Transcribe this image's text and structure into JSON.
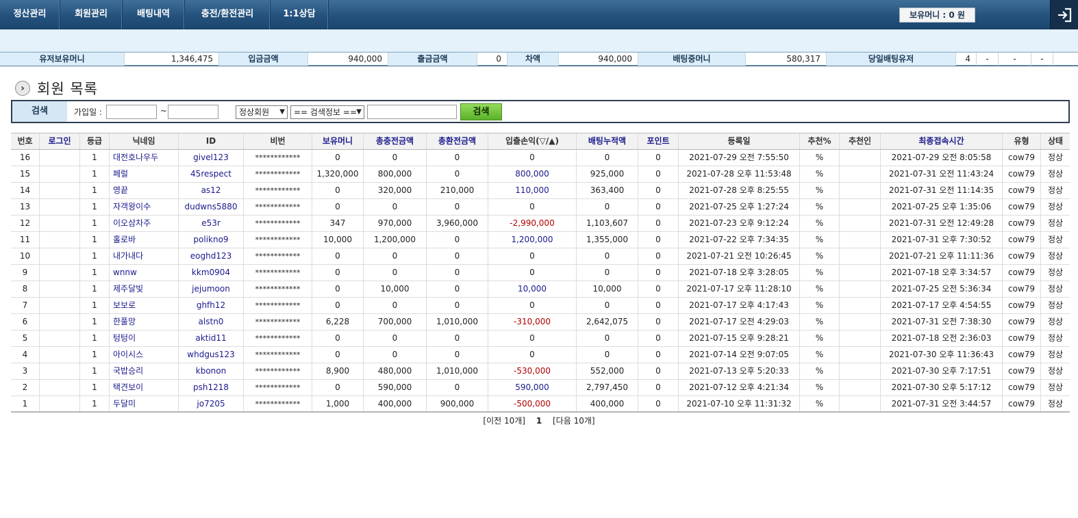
{
  "nav": {
    "items": [
      {
        "label": "정산관리"
      },
      {
        "label": "회원관리"
      },
      {
        "label": "배팅내역"
      },
      {
        "label": "충전/환전관리"
      },
      {
        "label": "1:1상담"
      }
    ],
    "money_text": "보유머니 : 0 원"
  },
  "stats": {
    "user_money_label": "유저보유머니",
    "user_money": "1,346,475",
    "deposit_label": "입금금액",
    "deposit": "940,000",
    "withdraw_label": "출금금액",
    "withdraw": "0",
    "diff_label": "차액",
    "diff": "940,000",
    "betting_label": "배팅중머니",
    "betting": "580,317",
    "today_label": "당일배팅유저",
    "today": "4",
    "dash1": "-",
    "dash2": "-",
    "dash3": "-"
  },
  "page_title": "회원 목록",
  "search": {
    "label": "검색",
    "join_label": "가입일 :",
    "tilde": "~",
    "date_from": "",
    "date_to": "",
    "status_select": "정상회원",
    "field_select": "== 검색정보 ==",
    "keyword": "",
    "button": "검색"
  },
  "table": {
    "headers": [
      "번호",
      "로그인",
      "등급",
      "닉네임",
      "ID",
      "비번",
      "보유머니",
      "총충전금액",
      "총환전금액",
      "입출손익(▽/▲)",
      "배팅누적액",
      "포인트",
      "등록일",
      "추천%",
      "추천인",
      "최종접속시간",
      "유형",
      "상태"
    ],
    "rows": [
      [
        "16",
        "",
        "1",
        "대전호나우두",
        "givel123",
        "************",
        "0",
        "0",
        "0",
        "0",
        "0",
        "0",
        "2021-07-29 오전 7:55:50",
        "%",
        "",
        "2021-07-29 오전 8:05:58",
        "cow79",
        "정상"
      ],
      [
        "15",
        "",
        "1",
        "페럴",
        "45respect",
        "************",
        "1,320,000",
        "800,000",
        "0",
        "800,000",
        "925,000",
        "0",
        "2021-07-28 오후 11:53:48",
        "%",
        "",
        "2021-07-31 오전 11:43:24",
        "cow79",
        "정상"
      ],
      [
        "14",
        "",
        "1",
        "영끝",
        "as12",
        "************",
        "0",
        "320,000",
        "210,000",
        "110,000",
        "363,400",
        "0",
        "2021-07-28 오후 8:25:55",
        "%",
        "",
        "2021-07-31 오전 11:14:35",
        "cow79",
        "정상"
      ],
      [
        "13",
        "",
        "1",
        "자객왕이수",
        "dudwns5880",
        "************",
        "0",
        "0",
        "0",
        "0",
        "0",
        "0",
        "2021-07-25 오후 1:27:24",
        "%",
        "",
        "2021-07-25 오후 1:35:06",
        "cow79",
        "정상"
      ],
      [
        "12",
        "",
        "1",
        "이오삼차주",
        "e53r",
        "************",
        "347",
        "970,000",
        "3,960,000",
        "-2,990,000",
        "1,103,607",
        "0",
        "2021-07-23 오후 9:12:24",
        "%",
        "",
        "2021-07-31 오전 12:49:28",
        "cow79",
        "정상"
      ],
      [
        "11",
        "",
        "1",
        "홀로바",
        "polikno9",
        "************",
        "10,000",
        "1,200,000",
        "0",
        "1,200,000",
        "1,355,000",
        "0",
        "2021-07-22 오후 7:34:35",
        "%",
        "",
        "2021-07-31 오후 7:30:52",
        "cow79",
        "정상"
      ],
      [
        "10",
        "",
        "1",
        "내가내다",
        "eoghd123",
        "************",
        "0",
        "0",
        "0",
        "0",
        "0",
        "0",
        "2021-07-21 오전 10:26:45",
        "%",
        "",
        "2021-07-21 오후 11:11:36",
        "cow79",
        "정상"
      ],
      [
        "9",
        "",
        "1",
        "wnnw",
        "kkm0904",
        "************",
        "0",
        "0",
        "0",
        "0",
        "0",
        "0",
        "2021-07-18 오후 3:28:05",
        "%",
        "",
        "2021-07-18 오후 3:34:57",
        "cow79",
        "정상"
      ],
      [
        "8",
        "",
        "1",
        "제주달빛",
        "jejumoon",
        "************",
        "0",
        "10,000",
        "0",
        "10,000",
        "10,000",
        "0",
        "2021-07-17 오후 11:28:10",
        "%",
        "",
        "2021-07-25 오전 5:36:34",
        "cow79",
        "정상"
      ],
      [
        "7",
        "",
        "1",
        "보보로",
        "ghfh12",
        "************",
        "0",
        "0",
        "0",
        "0",
        "0",
        "0",
        "2021-07-17 오후 4:17:43",
        "%",
        "",
        "2021-07-17 오후 4:54:55",
        "cow79",
        "정상"
      ],
      [
        "6",
        "",
        "1",
        "한풀망",
        "alstn0",
        "************",
        "6,228",
        "700,000",
        "1,010,000",
        "-310,000",
        "2,642,075",
        "0",
        "2021-07-17 오전 4:29:03",
        "%",
        "",
        "2021-07-31 오전 7:38:30",
        "cow79",
        "정상"
      ],
      [
        "5",
        "",
        "1",
        "텅텅이",
        "aktid11",
        "************",
        "0",
        "0",
        "0",
        "0",
        "0",
        "0",
        "2021-07-15 오후 9:28:21",
        "%",
        "",
        "2021-07-18 오전 2:36:03",
        "cow79",
        "정상"
      ],
      [
        "4",
        "",
        "1",
        "아이시스",
        "whdgus123",
        "************",
        "0",
        "0",
        "0",
        "0",
        "0",
        "0",
        "2021-07-14 오전 9:07:05",
        "%",
        "",
        "2021-07-30 오후 11:36:43",
        "cow79",
        "정상"
      ],
      [
        "3",
        "",
        "1",
        "국밥승리",
        "kbonon",
        "************",
        "8,900",
        "480,000",
        "1,010,000",
        "-530,000",
        "552,000",
        "0",
        "2021-07-13 오후 5:20:33",
        "%",
        "",
        "2021-07-30 오후 7:17:51",
        "cow79",
        "정상"
      ],
      [
        "2",
        "",
        "1",
        "택견보이",
        "psh1218",
        "************",
        "0",
        "590,000",
        "0",
        "590,000",
        "2,797,450",
        "0",
        "2021-07-12 오후 4:21:34",
        "%",
        "",
        "2021-07-30 오후 5:17:12",
        "cow79",
        "정상"
      ],
      [
        "1",
        "",
        "1",
        "두달미",
        "jo7205",
        "************",
        "1,000",
        "400,000",
        "900,000",
        "-500,000",
        "400,000",
        "0",
        "2021-07-10 오후 11:31:32",
        "%",
        "",
        "2021-07-31 오전 3:44:57",
        "cow79",
        "정상"
      ]
    ]
  },
  "pager": {
    "prev": "[이전 10개]",
    "current": "1",
    "next": "[다음 10개]"
  },
  "colors": {
    "nav_bg": "#24527c",
    "label_bg": "#dbeefa",
    "link_blue": "#1a1a8c",
    "loss_red": "#b00000",
    "search_btn": "#59b129"
  },
  "icons": {
    "logout": "logout-icon",
    "section": "chevron-right-circle-icon"
  }
}
